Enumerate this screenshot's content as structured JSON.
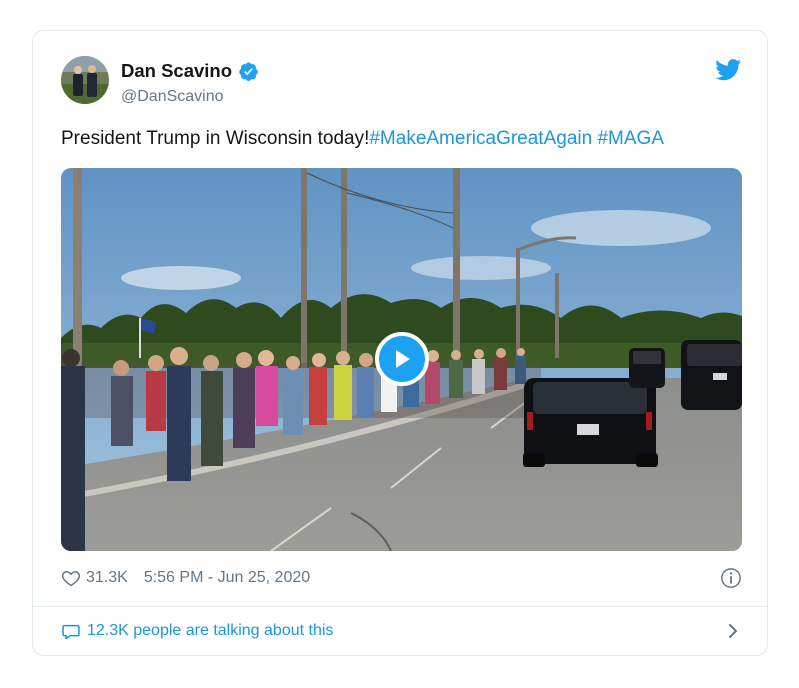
{
  "tweet": {
    "author_name": "Dan Scavino",
    "author_handle": "@DanScavino",
    "text_plain": "President Trump in Wisconsin today!",
    "hashtag_1": "#MakeAmericaGreatAgain",
    "hashtag_2": "#MAGA",
    "likes": "31.3K",
    "timestamp": "5:56 PM - Jun 25, 2020",
    "talking": "12.3K people are talking about this"
  },
  "icons": {
    "verified": "verified-badge-icon",
    "brand": "twitter-bird-icon",
    "play": "play-icon",
    "like": "heart-icon",
    "info": "info-icon",
    "reply": "comment-bubble-icon",
    "more": "chevron-right-icon"
  },
  "colors": {
    "brand": "#1da1f2",
    "link": "#1b95e0",
    "muted": "#657786",
    "text": "#14171a",
    "border": "#e1e8ed"
  }
}
